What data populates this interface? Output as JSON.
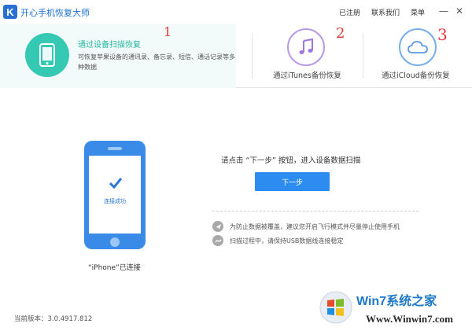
{
  "window": {
    "logo_letter": "K",
    "title": "开心手机恢复大师",
    "links": [
      "已注册",
      "联系我们",
      "菜单"
    ],
    "minimize_glyph": "—",
    "close_glyph": "✕"
  },
  "modes": {
    "device": {
      "title": "通过设备扫描恢复",
      "description": "可恢复苹果设备的通讯录、备忘录、短信、通话记录等多种数据",
      "icon": "phone-icon"
    },
    "itunes": {
      "label": "通过iTunes备份恢复",
      "icon": "music-note-icon"
    },
    "icloud": {
      "label": "通过iCloud备份恢复",
      "icon": "cloud-icon"
    },
    "annotations": [
      "1",
      "2",
      "3"
    ]
  },
  "device": {
    "status": "连接成功",
    "name": "“iPhone”已连接"
  },
  "main": {
    "instruction": "请点击 “下一步” 按钮，进入设备数据扫描",
    "next_button": "下一步",
    "tips": [
      "为防止数据被覆盖，建议您开启飞行模式并尽量停止使用手机",
      "扫描过程中，请保持USB数据线连接稳定"
    ]
  },
  "footer": {
    "version": "当前版本：3.0.4917.812"
  },
  "watermark": {
    "brand": "Win7系统之家",
    "url": "Www.Winwin7.com"
  },
  "colors": {
    "accent_blue": "#2d8cf0",
    "teal": "#35c9b4",
    "purple": "#b89be6",
    "sky": "#7aaee9",
    "annotation_red": "#e23a3a"
  }
}
